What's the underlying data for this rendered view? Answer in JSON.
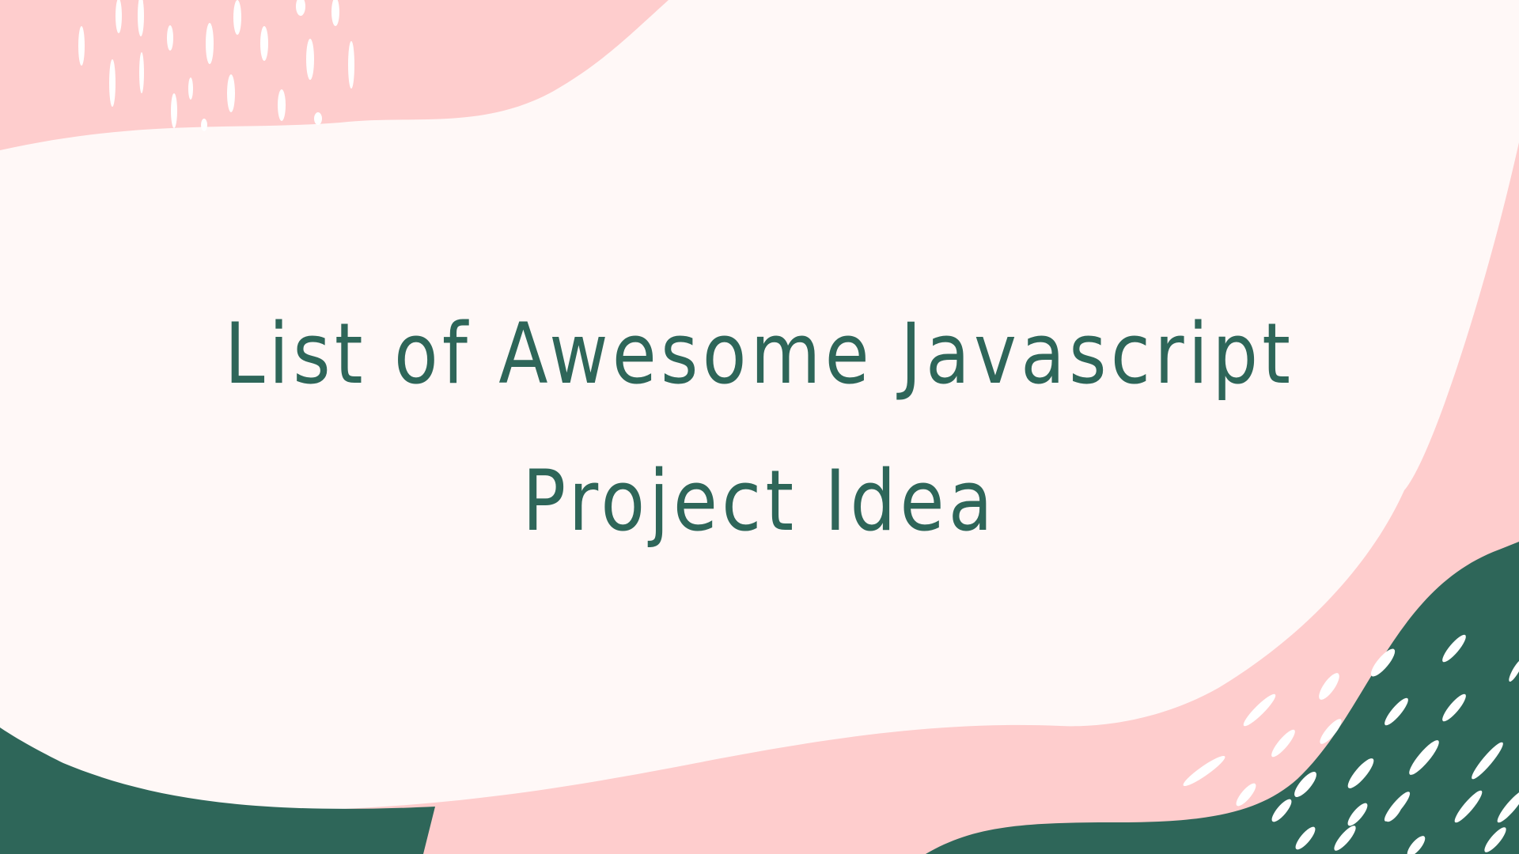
{
  "slide": {
    "title": "List of Awesome Javascript Project Idea"
  },
  "colors": {
    "background": "#fff8f7",
    "pink": "#fecdcd",
    "green": "#2e6659",
    "title": "#2e6659",
    "accent_marks": "#ffffff"
  }
}
